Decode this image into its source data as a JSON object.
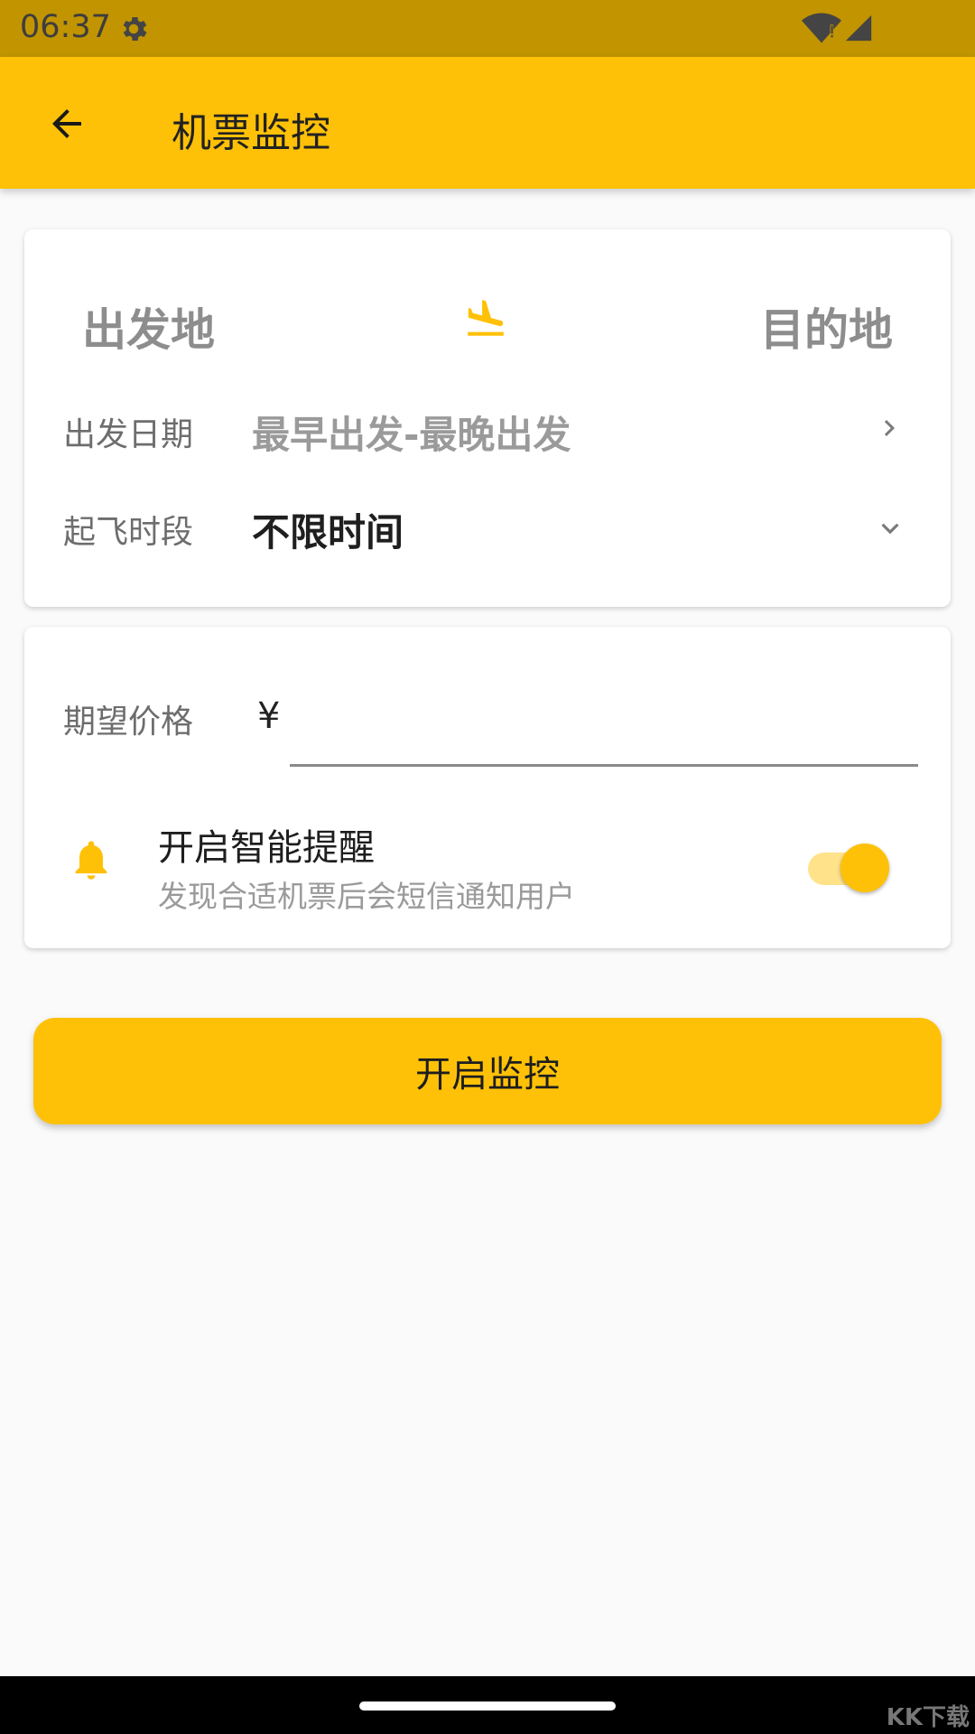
{
  "status_bar": {
    "time": "06:37",
    "icons": [
      "gear-icon",
      "wifi-icon",
      "signal-icon"
    ]
  },
  "app_bar": {
    "title": "机票监控",
    "back_icon": "arrow-left-icon"
  },
  "route": {
    "origin": "出发地",
    "destination": "目的地",
    "icon": "plane-landing-icon"
  },
  "date_row": {
    "label": "出发日期",
    "value": "最早出发-最晚出发",
    "icon": "chevron-right-icon"
  },
  "time_row": {
    "label": "起飞时段",
    "value": "不限时间",
    "icon": "chevron-down-icon"
  },
  "price": {
    "label": "期望价格",
    "currency": "¥",
    "value": "",
    "placeholder": ""
  },
  "reminder": {
    "title": "开启智能提醒",
    "subtitle": "发现合适机票后会短信通知用户",
    "icon": "bell-icon",
    "enabled": true
  },
  "action": {
    "label": "开启监控"
  },
  "watermark": "KK下载",
  "colors": {
    "accent": "#FFC107",
    "status_bar": "#C19400",
    "background": "#FAFAFA"
  }
}
